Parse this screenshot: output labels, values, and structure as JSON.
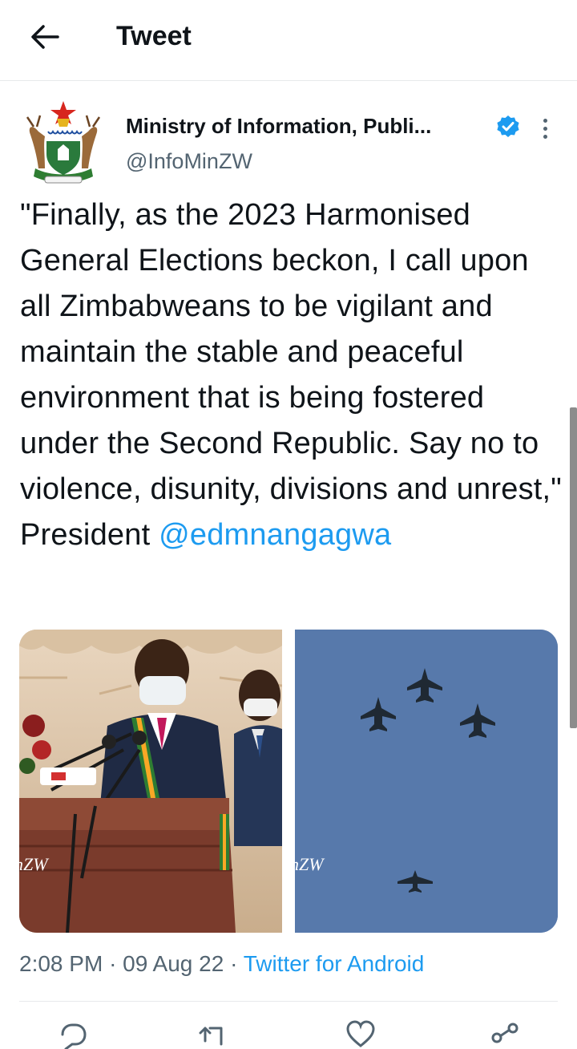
{
  "header": {
    "title": "Tweet",
    "back_icon": "arrow-left-icon"
  },
  "author": {
    "name": "Ministry of Information, Publi...",
    "handle": "@InfoMinZW",
    "verified": true,
    "avatar_icon": "zimbabwe-coat-of-arms"
  },
  "tweet": {
    "text": "\"Finally, as the 2023 Harmonised General Elections beckon, I call upon all Zimbabweans to be vigilant and maintain the stable and peaceful environment that is being fostered under the Second Republic.  Say no to violence, disunity, divisions and unrest,\" President ",
    "mention": "@edmnangagwa"
  },
  "media": {
    "photos": [
      {
        "watermark": "nZW"
      },
      {
        "watermark": "nZW"
      }
    ]
  },
  "meta": {
    "time": "2:08 PM",
    "separator": "·",
    "date": "09 Aug 22",
    "source": "Twitter for Android"
  },
  "actions": [
    "reply-icon",
    "retweet-icon",
    "like-icon",
    "share-icon"
  ],
  "colors": {
    "accent": "#1d9bf0",
    "text": "#0f1419",
    "secondary": "#536471"
  }
}
